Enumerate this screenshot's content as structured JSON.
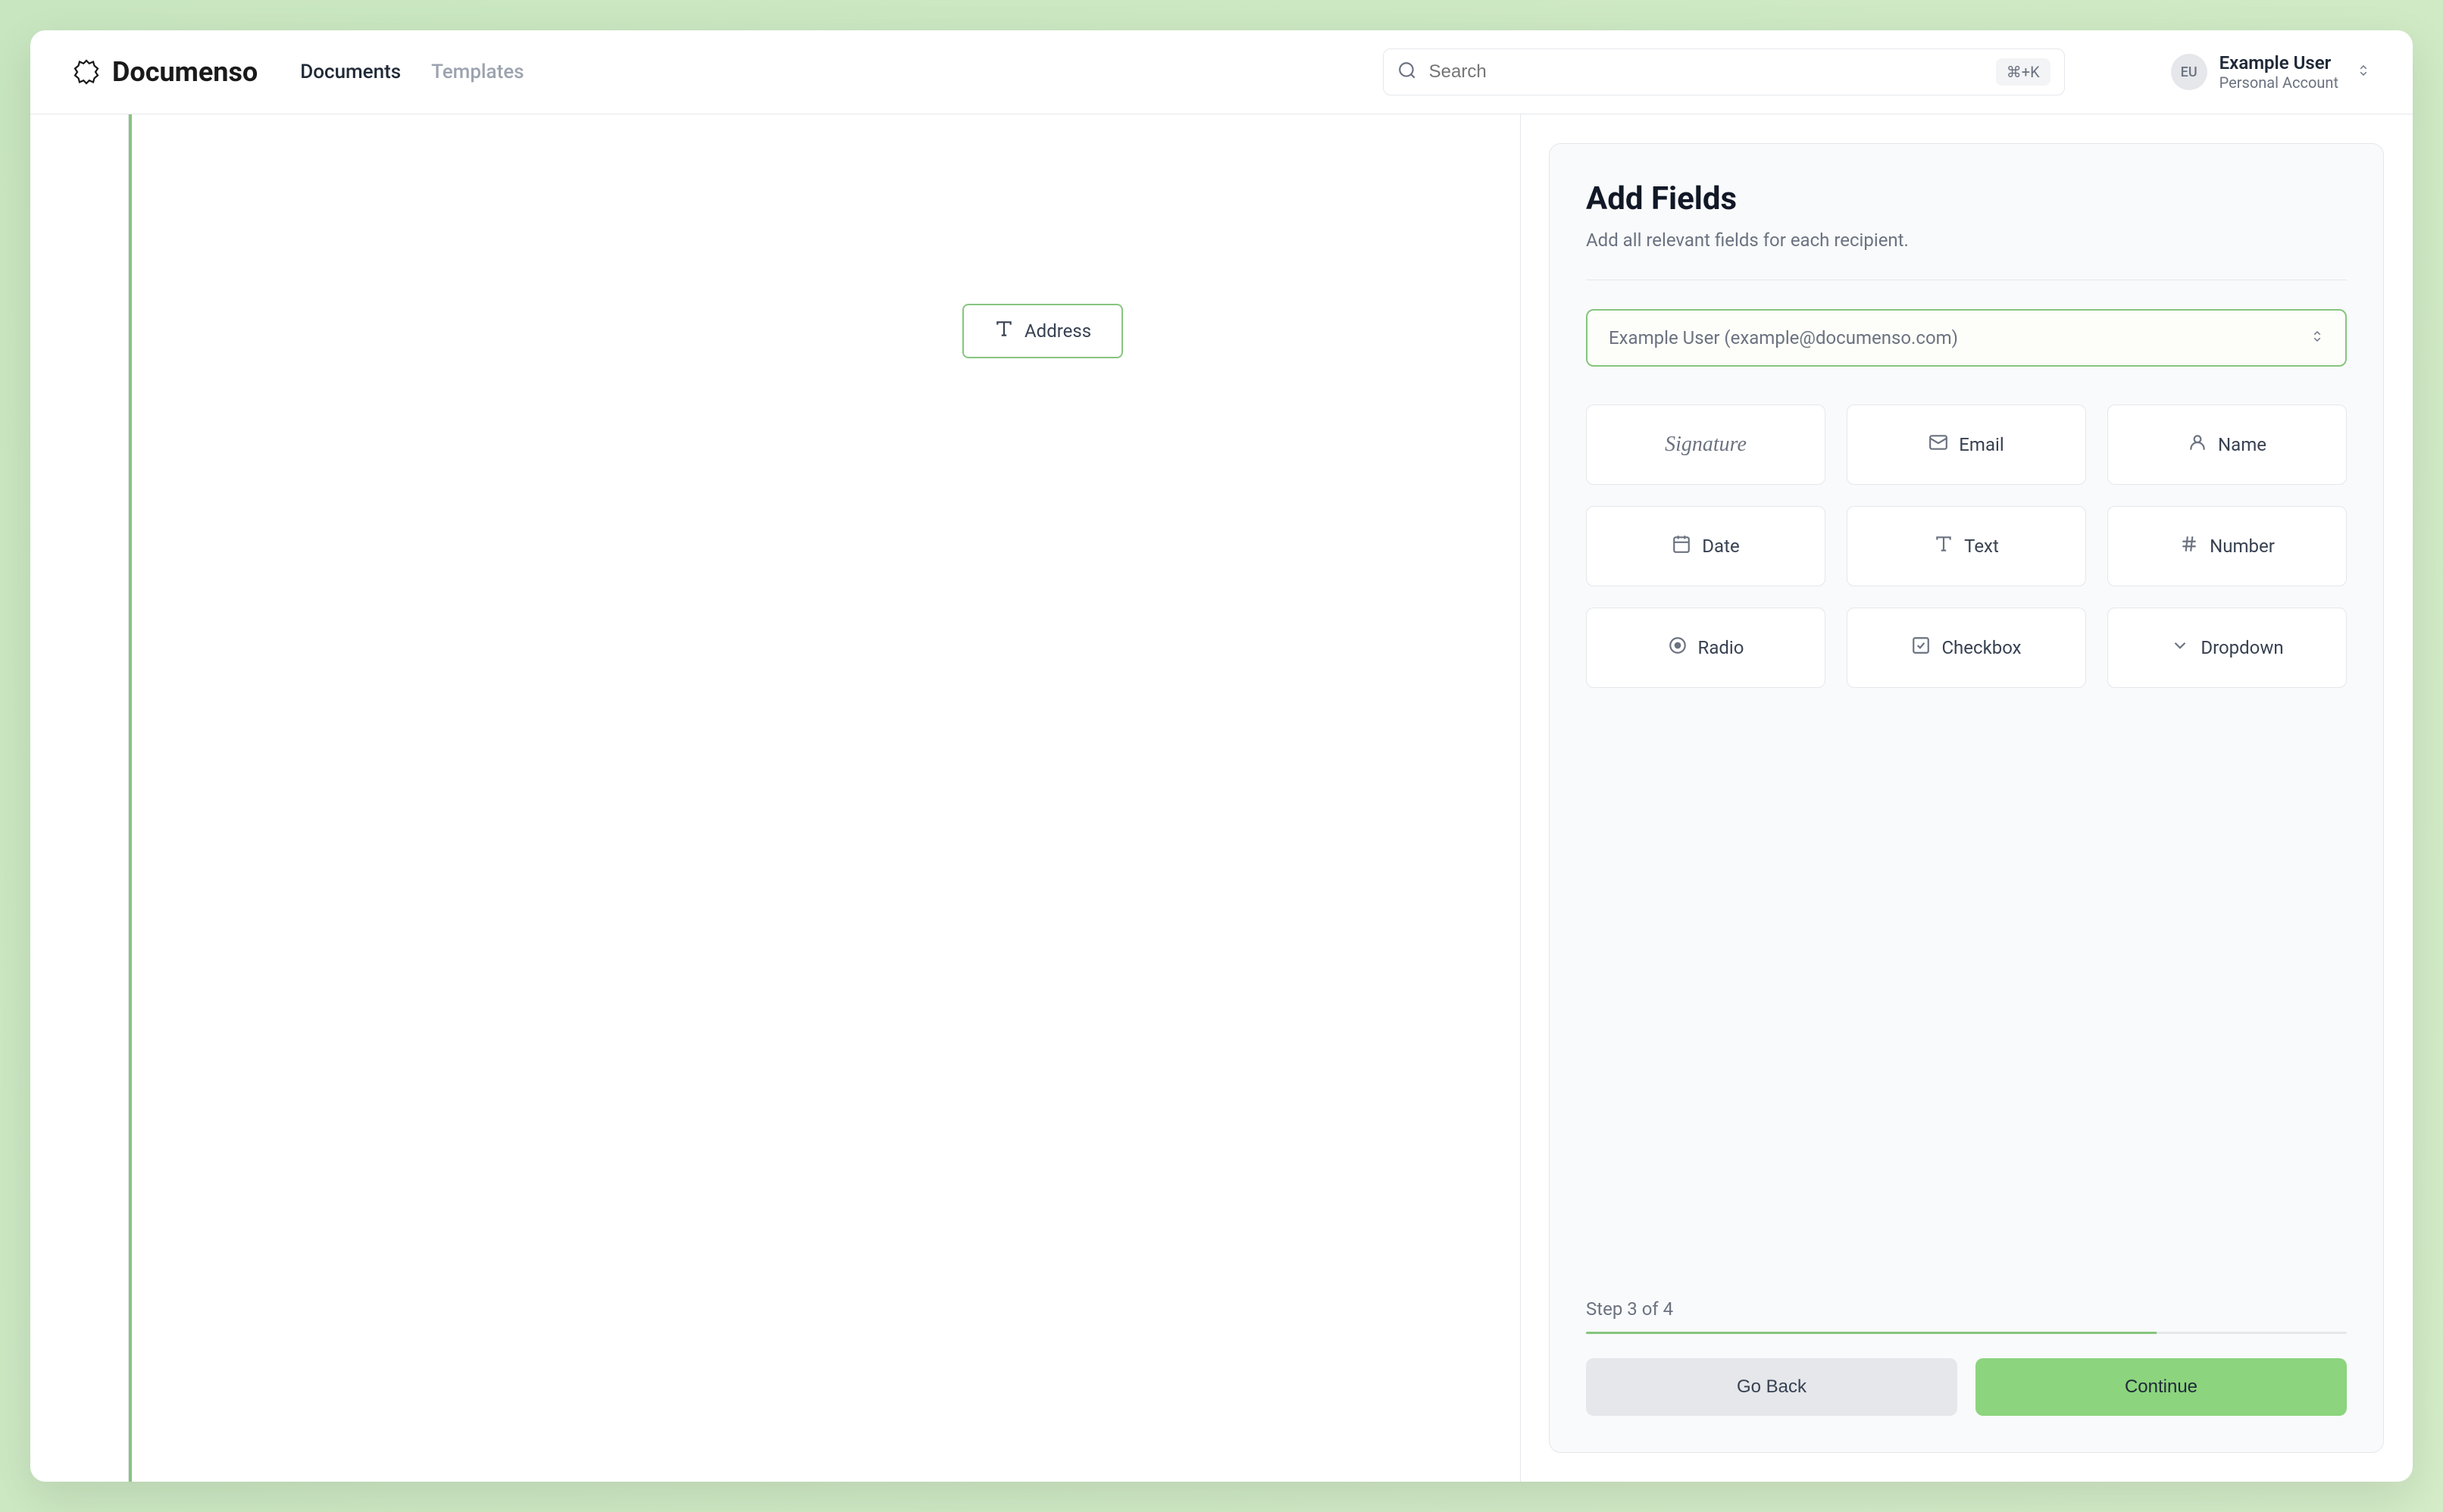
{
  "header": {
    "brand": "Documenso",
    "nav": {
      "documents": "Documents",
      "templates": "Templates"
    },
    "search": {
      "placeholder": "Search",
      "shortcut": "⌘+K"
    },
    "user": {
      "initials": "EU",
      "name": "Example User",
      "account": "Personal Account"
    }
  },
  "document": {
    "placed_field": {
      "label": "Address"
    }
  },
  "sidebar": {
    "title": "Add Fields",
    "subtitle": "Add all relevant fields for each recipient.",
    "recipient": "Example User (example@documenso.com)",
    "fields": {
      "signature": "Signature",
      "email": "Email",
      "name": "Name",
      "date": "Date",
      "text": "Text",
      "number": "Number",
      "radio": "Radio",
      "checkbox": "Checkbox",
      "dropdown": "Dropdown"
    },
    "step": "Step 3 of 4",
    "buttons": {
      "back": "Go Back",
      "continue": "Continue"
    }
  }
}
